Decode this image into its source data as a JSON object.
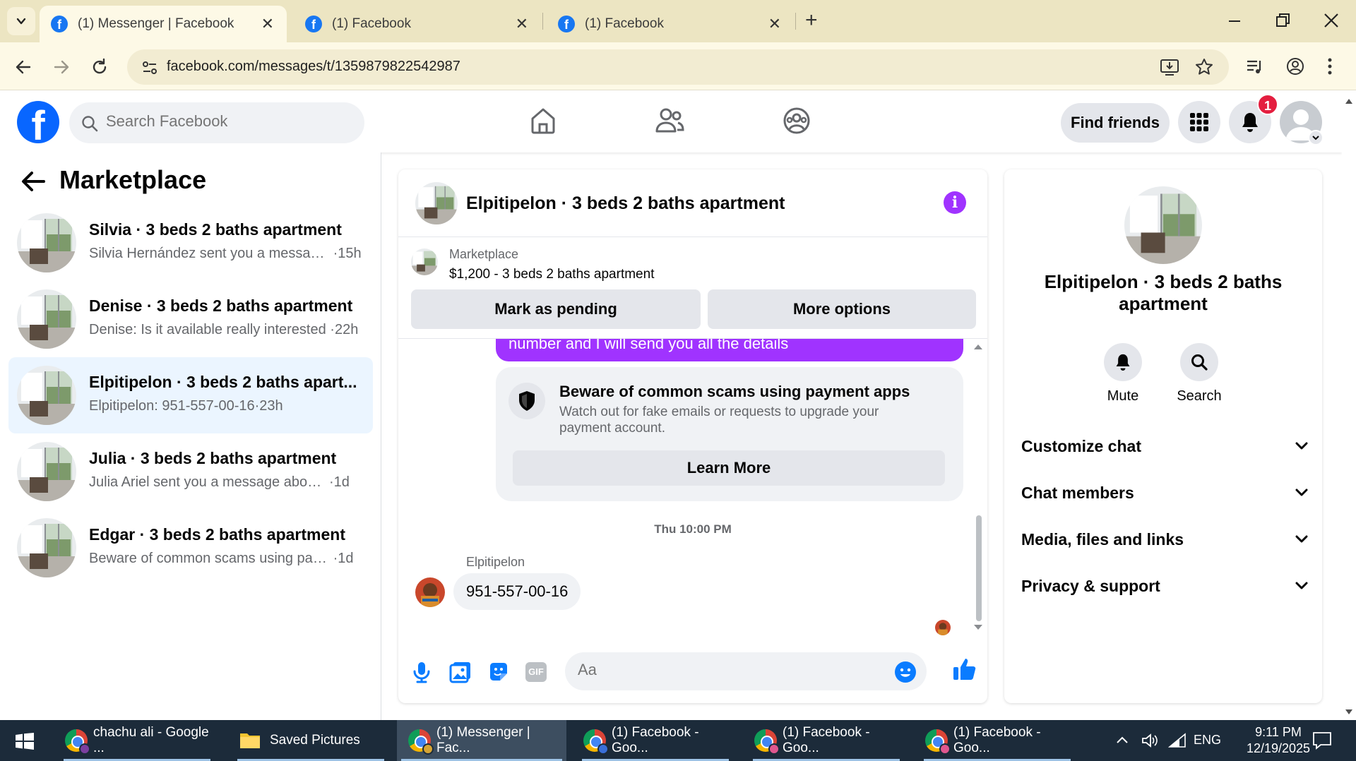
{
  "browser": {
    "tabs": [
      {
        "title": "(1) Messenger | Facebook",
        "active": true
      },
      {
        "title": "(1) Facebook",
        "active": false
      },
      {
        "title": "(1) Facebook",
        "active": false
      }
    ],
    "new_tab": "+",
    "url": "facebook.com/messages/t/1359879822542987"
  },
  "header": {
    "logo": "f",
    "search_placeholder": "Search Facebook",
    "find_friends": "Find friends",
    "notif_count": "1"
  },
  "sidebar": {
    "title": "Marketplace",
    "conversations": [
      {
        "name": "Silvia · 3 beds 2 baths apartment",
        "preview": "Silvia Hernández sent you a message...",
        "time": "·15h",
        "selected": false
      },
      {
        "name": "Denise · 3 beds 2 baths apartment",
        "preview": "Denise: Is it available really interested",
        "time": "·22h",
        "selected": false
      },
      {
        "name": "Elpitipelon · 3 beds 2 baths apart...",
        "preview": "Elpitipelon: 951-557-00-16",
        "time": "·23h",
        "selected": true
      },
      {
        "name": "Julia · 3 beds 2 baths apartment",
        "preview": "Julia Ariel sent you a message about y...",
        "time": "·1d",
        "selected": false
      },
      {
        "name": "Edgar · 3 beds 2 baths apartment",
        "preview": "Beware of common scams using pay...",
        "time": "·1d",
        "selected": false
      }
    ]
  },
  "chat": {
    "title": "Elpitipelon · 3 beds 2 baths apartment",
    "info_icon": "i",
    "listing": {
      "label": "Marketplace",
      "price_title": "$1,200 - 3 beds 2 baths apartment",
      "mark_pending": "Mark as pending",
      "more_options": "More options"
    },
    "outgoing_partial": "number and I will send you all the details",
    "scam_card": {
      "title": "Beware of common scams using payment apps",
      "text": "Watch out for fake emails or requests to upgrade your payment account.",
      "button": "Learn More"
    },
    "timestamp": "Thu 10:00 PM",
    "sender": "Elpitipelon",
    "message": "951-557-00-16",
    "input_placeholder": "Aa"
  },
  "right_panel": {
    "name": "Elpitipelon · 3 beds 2 baths apartment",
    "actions": [
      {
        "label": "Mute",
        "icon": "bell-icon"
      },
      {
        "label": "Search",
        "icon": "search-icon"
      }
    ],
    "sections": [
      "Customize chat",
      "Chat members",
      "Media, files and links",
      "Privacy & support"
    ]
  },
  "taskbar": {
    "items": [
      {
        "label": "chachu ali - Google ...",
        "active": false
      },
      {
        "label": "Saved Pictures",
        "active": false
      },
      {
        "label": "(1) Messenger | Fac...",
        "active": true
      },
      {
        "label": "(1) Facebook - Goo...",
        "active": false
      },
      {
        "label": "(1) Facebook - Goo...",
        "active": false
      },
      {
        "label": "(1) Facebook - Goo...",
        "active": false
      }
    ],
    "language": "ENG",
    "time": "9:11 PM",
    "date": "12/19/2025"
  },
  "colors": {
    "fb_blue": "#0866ff",
    "messenger_purple": "#a033ff",
    "selected_bg": "#ebf5ff",
    "taskbar": "#1c2b3a"
  }
}
